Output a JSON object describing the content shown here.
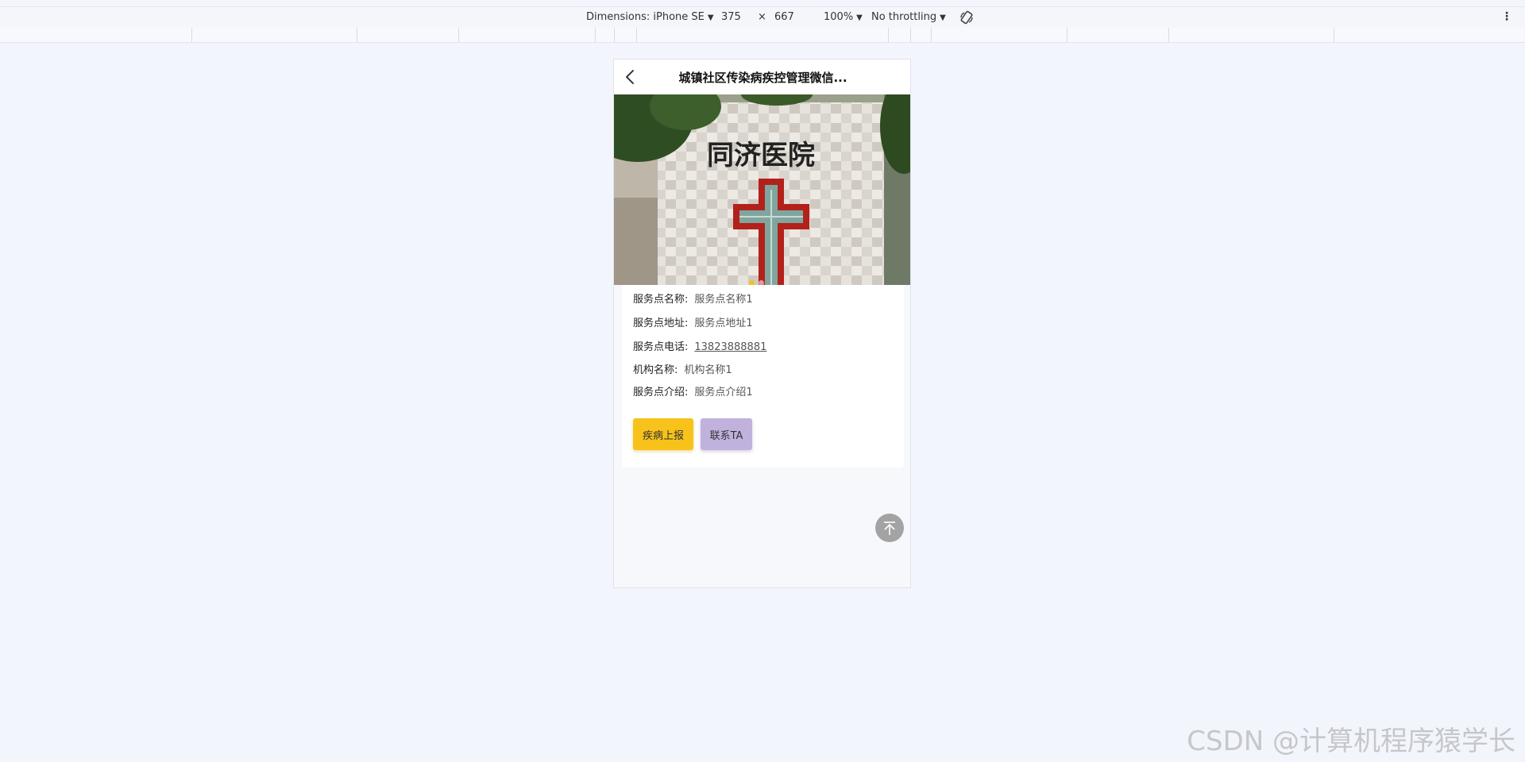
{
  "devtools": {
    "dimensions_label": "Dimensions: iPhone SE",
    "width": "375",
    "times": "×",
    "height": "667",
    "zoom": "100%",
    "throttling": "No throttling"
  },
  "page": {
    "title": "城镇社区传染病疾控管理微信...",
    "banner": {
      "sign_text": "同济医院",
      "slides": 2,
      "active_slide": 1
    },
    "details": [
      {
        "label": "服务点名称:",
        "value": "服务点名称1"
      },
      {
        "label": "服务点地址:",
        "value": "服务点地址1"
      },
      {
        "label": "服务点电话:",
        "value": "13823888881"
      },
      {
        "label": "机构名称:",
        "value": "机构名称1"
      },
      {
        "label": "服务点介绍:",
        "value": "服务点介绍1"
      }
    ],
    "buttons": {
      "report": "疾病上报",
      "contact": "联系TA"
    }
  },
  "watermark": "CSDN @计算机程序猿学长",
  "icons": [
    "rotate-icon",
    "more-icon",
    "back-icon",
    "back-to-top-icon"
  ],
  "colors": {
    "report_button": "#f7c21a",
    "contact_button": "#c0b2dc",
    "active_dot": "#f5c01d",
    "page_background": "#f2f5fc"
  }
}
